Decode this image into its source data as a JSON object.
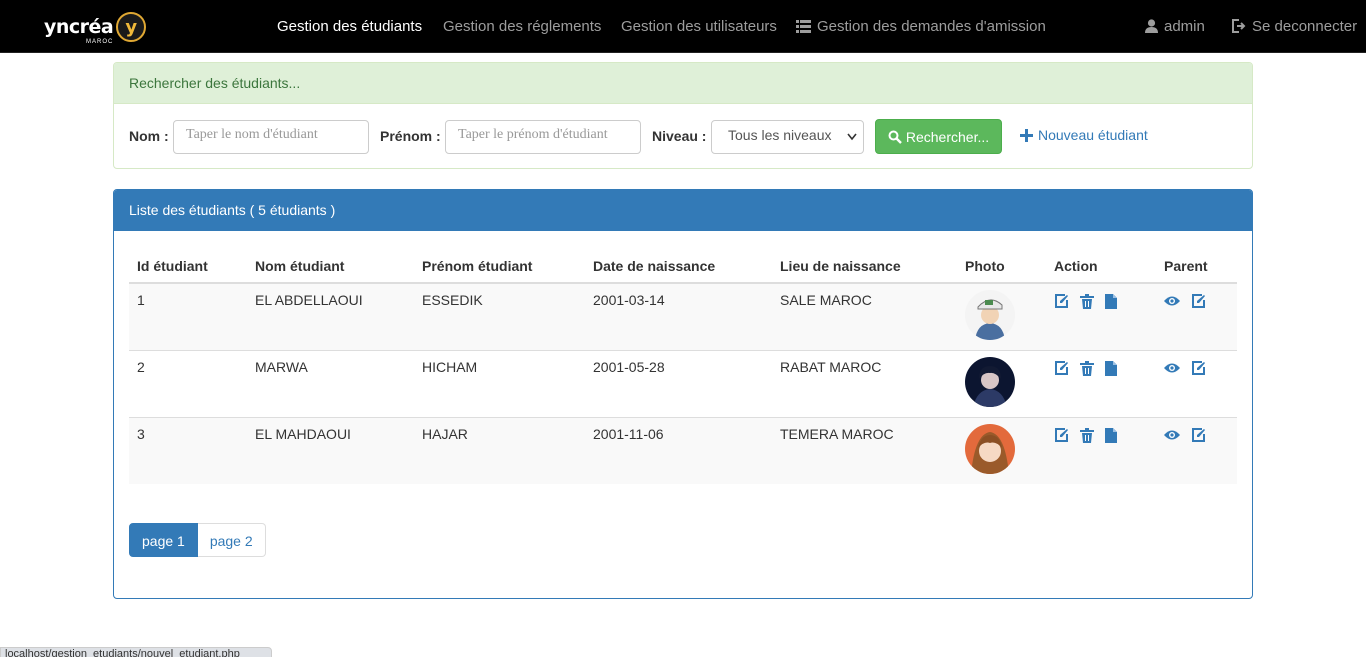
{
  "navbar": {
    "brand": "yncréa",
    "brand_sub": "MAROC",
    "brand_letter": "y",
    "items": [
      {
        "label": "Gestion des étudiants",
        "active": true
      },
      {
        "label": "Gestion des réglements",
        "active": false
      },
      {
        "label": "Gestion des utilisateurs",
        "active": false
      },
      {
        "label": "Gestion des demandes d'amission",
        "active": false,
        "icon": "list-icon"
      }
    ],
    "user": {
      "label": "admin",
      "icon": "user-icon"
    },
    "logout": {
      "label": "Se deconnecter",
      "icon": "logout-icon"
    }
  },
  "search": {
    "heading": "Rechercher des étudiants...",
    "nom_label": "Nom :",
    "nom_placeholder": "Taper le nom d'étudiant",
    "prenom_label": "Prénom :",
    "prenom_placeholder": "Taper le prénom d'étudiant",
    "niveau_label": "Niveau :",
    "niveau_value": "Tous les niveaux",
    "search_button": "Rechercher...",
    "new_student_link": "Nouveau étudiant"
  },
  "list": {
    "heading": "Liste des étudiants ( 5 étudiants )",
    "columns": [
      "Id étudiant",
      "Nom étudiant",
      "Prénom étudiant",
      "Date de naissance",
      "Lieu de naissance",
      "Photo",
      "Action",
      "Parent"
    ],
    "rows": [
      {
        "id": "1",
        "nom": "EL ABDELLAOUI",
        "prenom": "ESSEDIK",
        "date": "2001-03-14",
        "lieu": "SALE MAROC"
      },
      {
        "id": "2",
        "nom": "MARWA",
        "prenom": "HICHAM",
        "date": "2001-05-28",
        "lieu": "RABAT MAROC"
      },
      {
        "id": "3",
        "nom": "EL MAHDAOUI",
        "prenom": "HAJAR",
        "date": "2001-11-06",
        "lieu": "TEMERA MAROC"
      }
    ],
    "pages": [
      "page 1",
      "page 2"
    ]
  },
  "status_bar": "localhost/gestion_etudiants/nouvel_etudiant.php",
  "colors": {
    "primary": "#337ab7",
    "success": "#5cb85c",
    "success_bg": "#dff0d8",
    "navbar": "#000000"
  }
}
